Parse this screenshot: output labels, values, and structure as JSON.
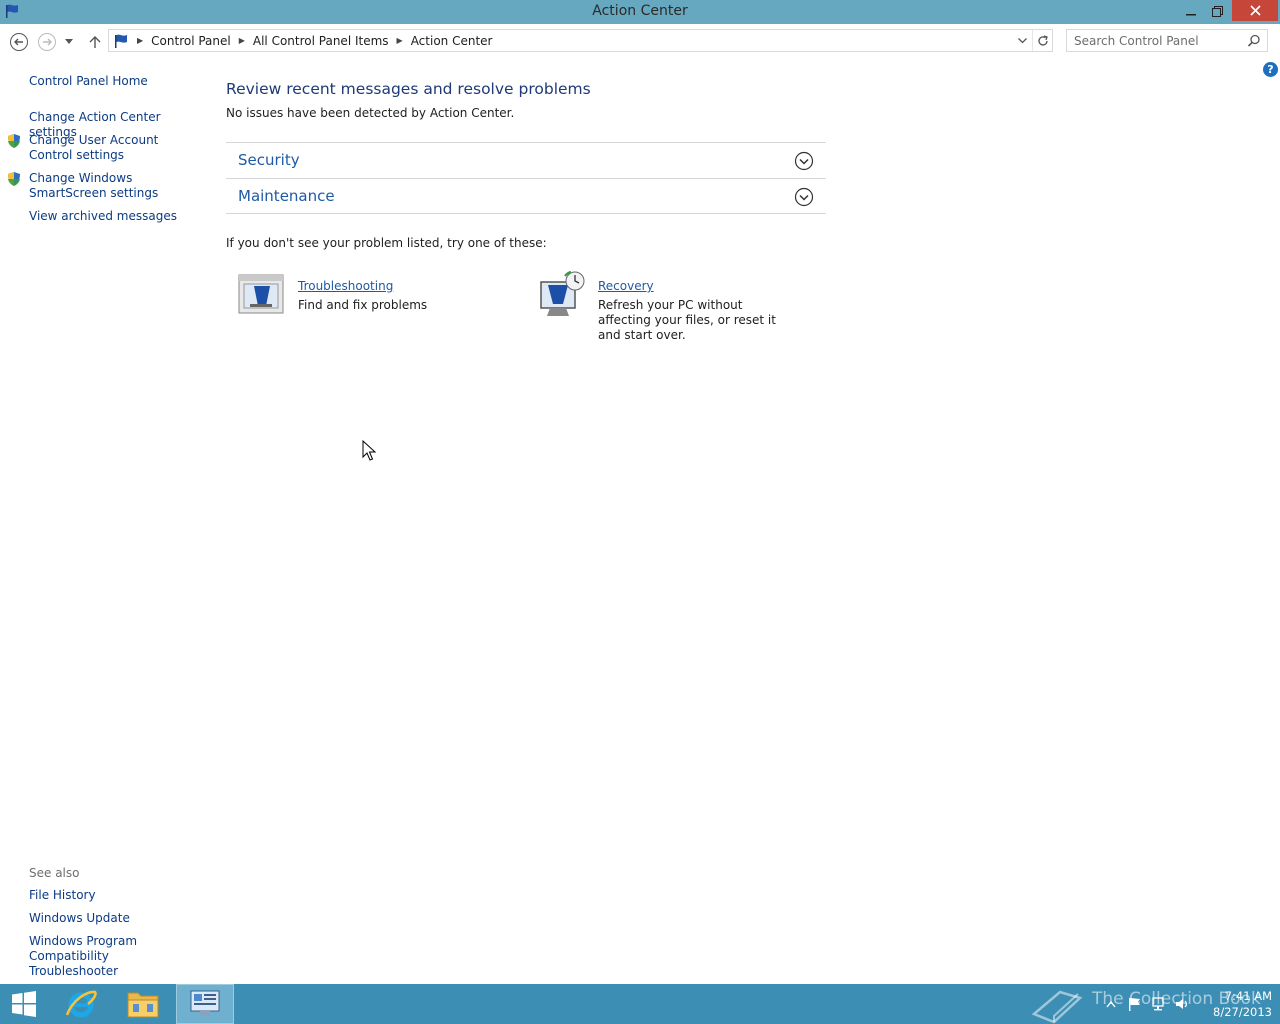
{
  "window": {
    "title": "Action Center"
  },
  "address": {
    "crumbs": [
      "Control Panel",
      "All Control Panel Items",
      "Action Center"
    ]
  },
  "search": {
    "placeholder": "Search Control Panel"
  },
  "help": {
    "label": "?"
  },
  "sidebar": {
    "home": "Control Panel Home",
    "links": [
      "Change Action Center settings",
      "Change User Account Control settings",
      "Change Windows SmartScreen settings",
      "View archived messages"
    ],
    "see_also_heading": "See also",
    "see_also": [
      "File History",
      "Windows Update",
      "Windows Program Compatibility Troubleshooter"
    ]
  },
  "main": {
    "title": "Review recent messages and resolve problems",
    "subtitle": "No issues have been detected by Action Center.",
    "sections": [
      "Security",
      "Maintenance"
    ],
    "hint": "If you don't see your problem listed, try one of these:",
    "tools": [
      {
        "title": "Troubleshooting",
        "description": "Find and fix problems"
      },
      {
        "title": "Recovery",
        "description": "Refresh your PC without affecting your files, or reset it and start over."
      }
    ]
  },
  "taskbar": {
    "watermark": "The Collection Book",
    "time": "7:41 AM",
    "date": "8/27/2013"
  },
  "colors": {
    "titlebar": "#67a8c1",
    "close_button": "#c7463a",
    "taskbar": "#3d8eb4",
    "link": "#1e5aa6"
  }
}
